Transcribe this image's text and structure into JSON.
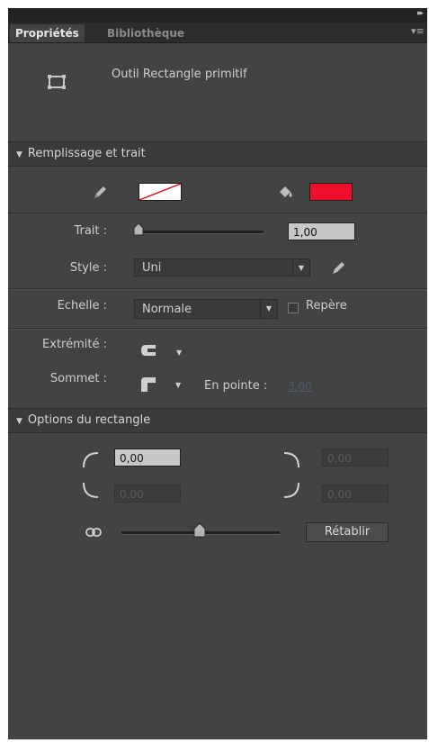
{
  "tabs": [
    {
      "label": "Propriétés",
      "active": true
    },
    {
      "label": "Bibliothèque",
      "active": false
    }
  ],
  "tool": {
    "icon": "rectangle-primitive-icon",
    "title": "Outil Rectangle primitif"
  },
  "fill_stroke": {
    "header": "Remplissage et trait",
    "stroke_color": "none",
    "fill_color": "#ee0f2d",
    "trait_label": "Trait :",
    "trait_value": "1,00",
    "style_label": "Style :",
    "style_value": "Uni",
    "echelle_label": "Echelle :",
    "echelle_value": "Normale",
    "repere_label": "Repère",
    "extremite_label": "Extrémité :",
    "sommet_label": "Sommet :",
    "en_pointe_label": "En pointe :",
    "en_pointe_value": "3,00"
  },
  "rect_options": {
    "header": "Options du rectangle",
    "top_left": "0,00",
    "top_right": "0,00",
    "bottom_left": "0,00",
    "bottom_right": "0,00",
    "reset_label": "Rétablir"
  }
}
